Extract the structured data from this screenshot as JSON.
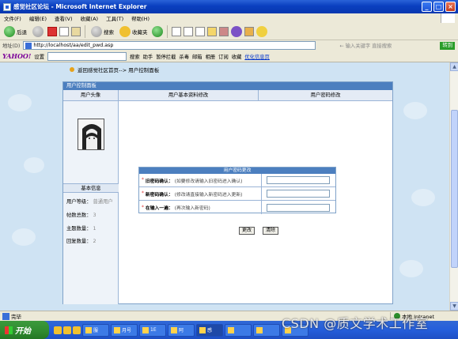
{
  "window": {
    "title": "感觉社区论坛 - Microsoft Internet Explorer",
    "buttons": [
      "_",
      "□",
      "×"
    ]
  },
  "menu": [
    "文件(F)",
    "编辑(E)",
    "查看(V)",
    "收藏(A)",
    "工具(T)",
    "帮助(H)"
  ],
  "toolbar": {
    "back": "后退",
    "search": "搜索",
    "favorites": "收藏夹"
  },
  "address": {
    "label": "地址(D)",
    "url": "http://localhost/aa/edit_pwd.asp",
    "search_hint": "← 输入关键字 直接搜索",
    "go": "转到"
  },
  "yahoo": {
    "logo": "YAHOO!",
    "settings": "设置",
    "search": "搜索",
    "helper": "助手",
    "popup": "暂停拦截",
    "antivirus": "杀毒",
    "mail": "邮箱",
    "album": "相册",
    "rss": "订阅",
    "fav": "收藏",
    "optimize": "优化信息页"
  },
  "breadcrumb": "返回感觉社区首页--> 用户控制面板",
  "panel": {
    "title": "用户控制面板",
    "col_avatar": "用户头像",
    "col_basic": "用户基本资料修改",
    "col_pwd": "用户密码修改"
  },
  "basic_info": {
    "title": "基本信息",
    "level_label": "用户等级：",
    "level_value": "普通用户",
    "posts_label": "帖数总数：",
    "posts_value": "3",
    "topics_label": "主题数量：",
    "topics_value": "1",
    "replies_label": "回复数量：",
    "replies_value": "2"
  },
  "pwd_form": {
    "title": "用户密码更改",
    "rows": [
      {
        "star": "*",
        "label": "旧密码确认：",
        "hint": "(如要修改请输入旧密码进入确认)"
      },
      {
        "star": "*",
        "label": "新密码确认：",
        "hint": "(修改请直接输入新密码进入更新)"
      },
      {
        "star": "*",
        "label": "在输入一遍：",
        "hint": "(再次输入新密码)"
      }
    ],
    "submit": "更改",
    "reset": "清除"
  },
  "status": {
    "text": "完毕",
    "zone": "本地 Intranet"
  },
  "taskbar": {
    "start": "开始",
    "tasks": [
      "服",
      "月号",
      "1E",
      "阿",
      "感",
      "",
      "",
      ""
    ]
  },
  "watermark": "CSDN @质文学术工作室",
  "colors": {
    "title_bar": "#0a3fbf",
    "panel_header": "#4c7fbf",
    "page_bg": "#cfe3f3"
  }
}
